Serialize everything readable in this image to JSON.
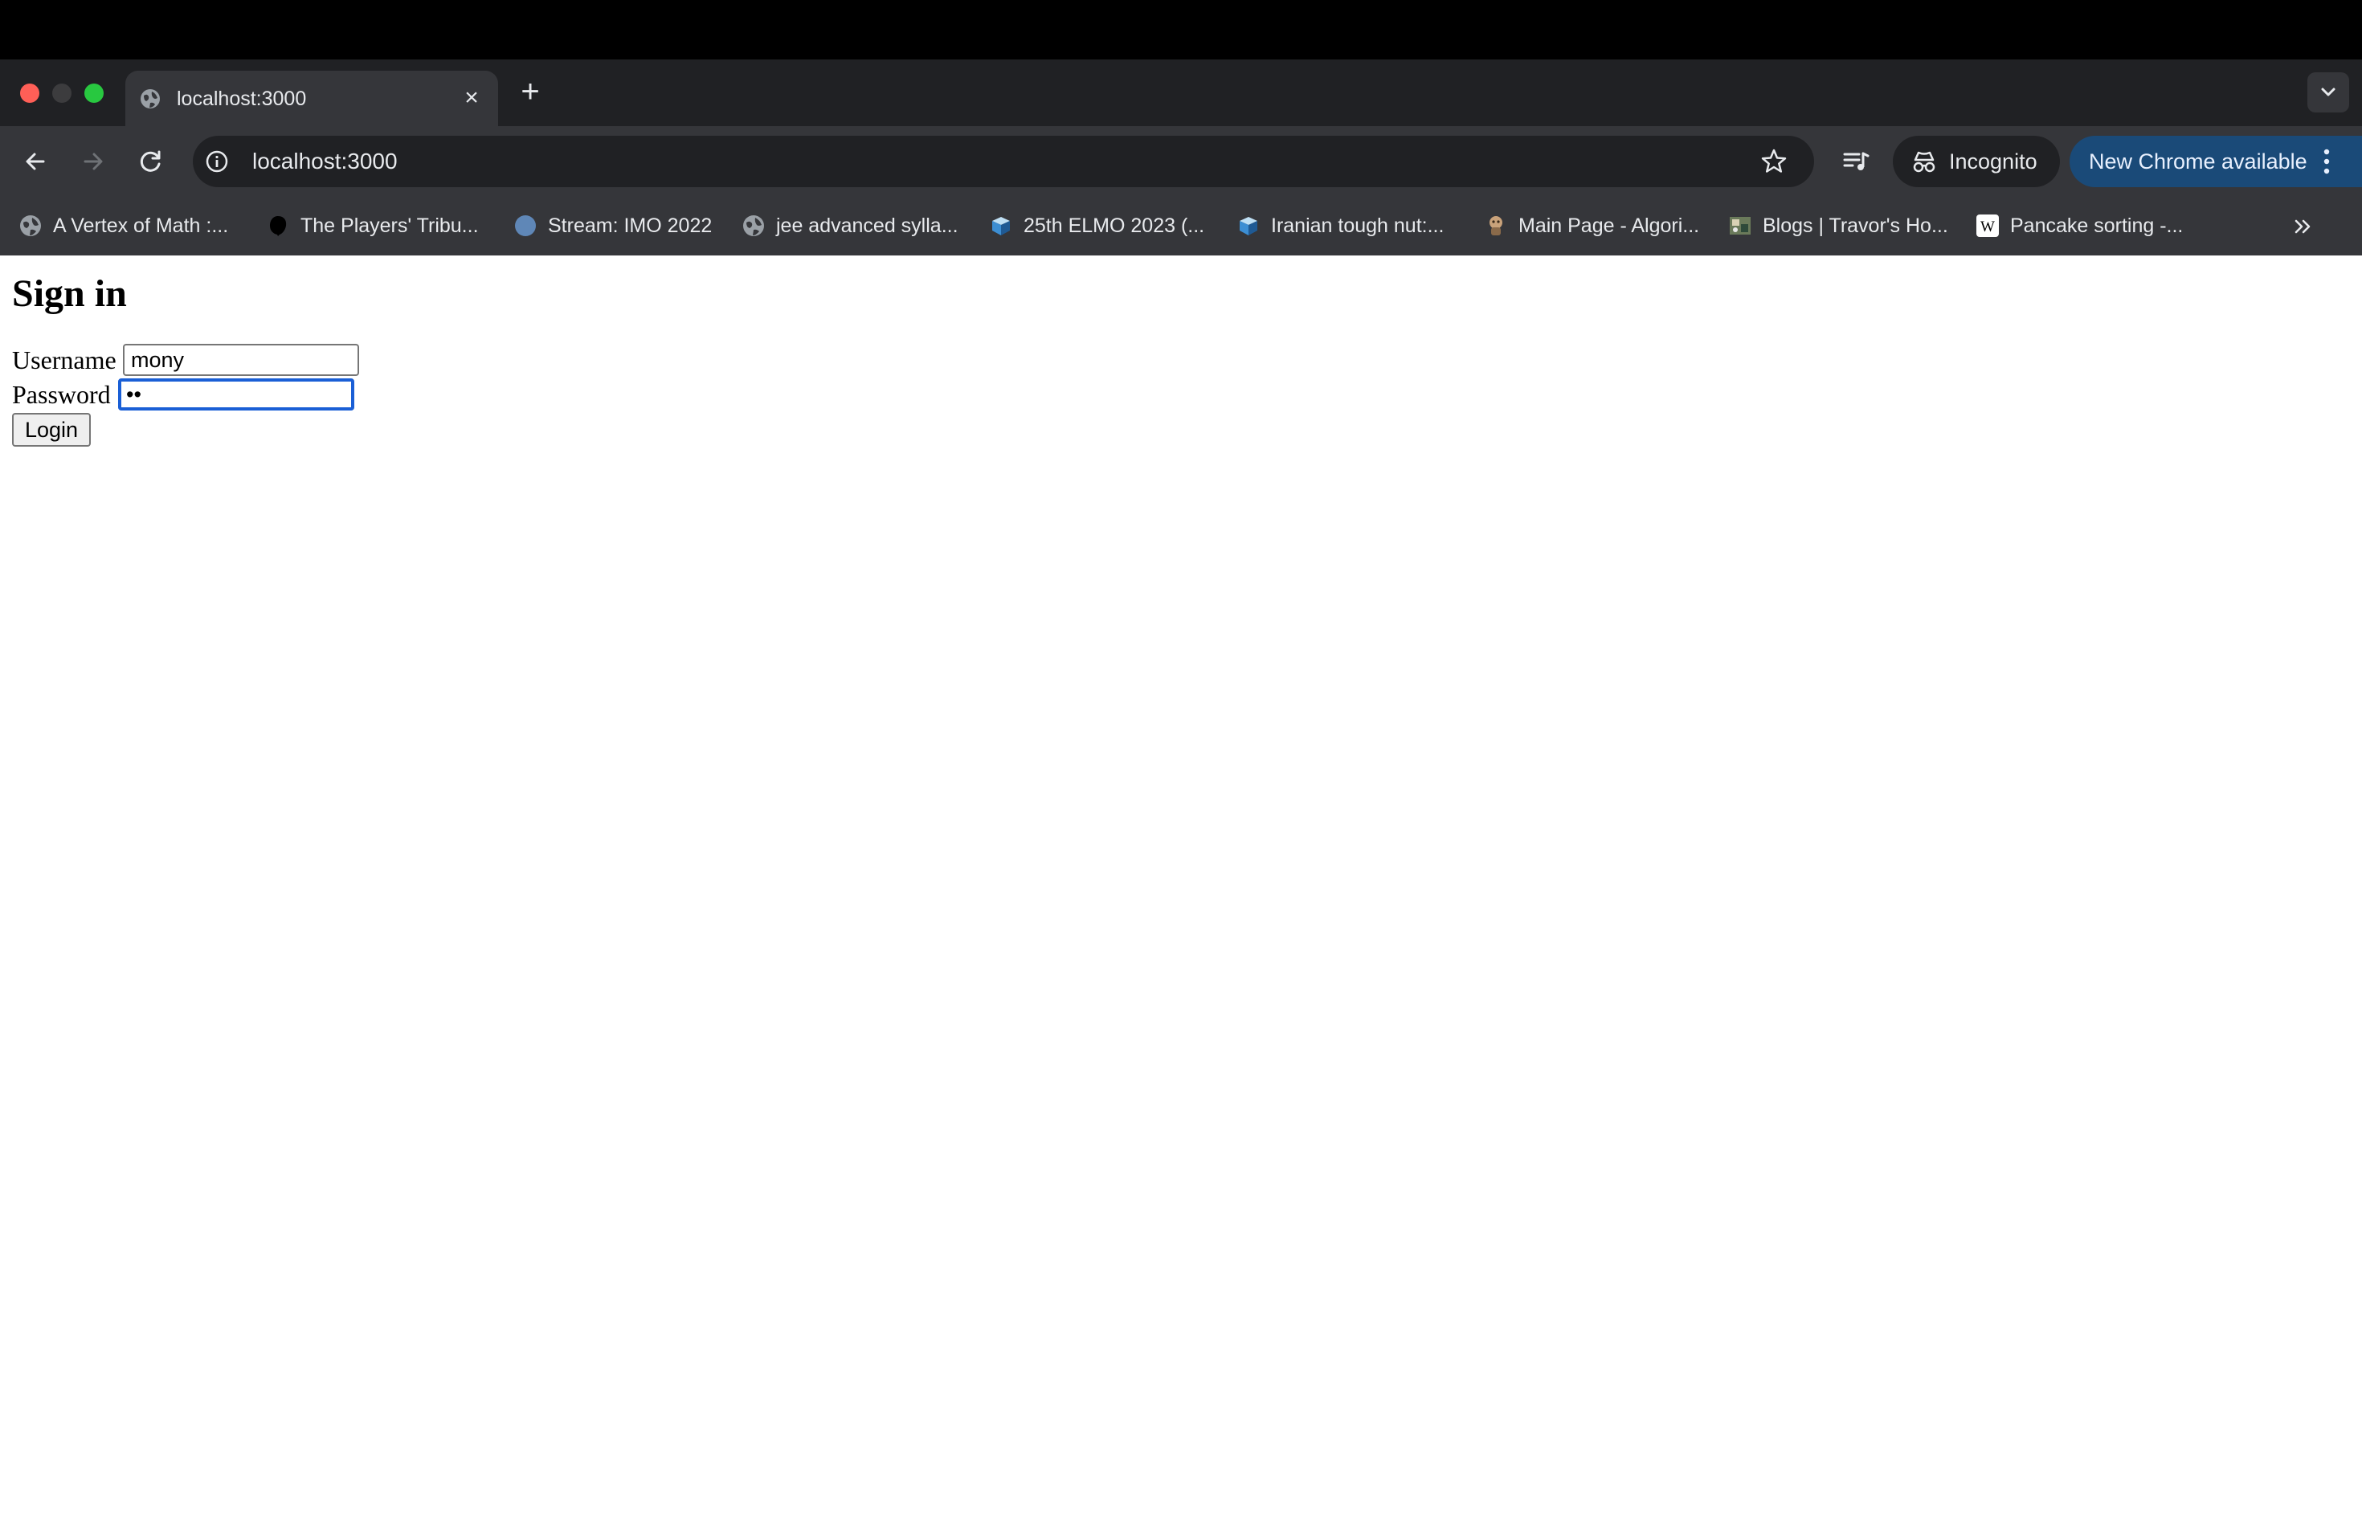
{
  "browser": {
    "tab": {
      "title": "localhost:3000"
    },
    "omnibox": {
      "url": "localhost:3000"
    },
    "incognito_label": "Incognito",
    "update_label": "New Chrome available",
    "bookmarks": [
      {
        "label": "A Vertex of Math :...",
        "icon": "globe-icon"
      },
      {
        "label": "The Players' Tribu...",
        "icon": "players-tribune-icon"
      },
      {
        "label": "Stream: IMO 2022",
        "icon": "zulip-icon"
      },
      {
        "label": "jee advanced sylla...",
        "icon": "globe-icon"
      },
      {
        "label": "25th ELMO 2023 (...",
        "icon": "aops-cube-icon"
      },
      {
        "label": "Iranian tough nut:...",
        "icon": "aops-cube-icon"
      },
      {
        "label": "Main Page - Algori...",
        "icon": "algorithmica-icon"
      },
      {
        "label": "Blogs | Travor's Ho...",
        "icon": "blog-thumbnail-icon"
      },
      {
        "label": "Pancake sorting -...",
        "icon": "wikipedia-icon"
      }
    ],
    "colors": {
      "tab_strip": "#202124",
      "toolbar": "#35363a",
      "update_pill": "#1a4a78",
      "focus_ring": "#1a5fd6"
    }
  },
  "page": {
    "title": "Sign in",
    "username_label": "Username",
    "username_value": "mony",
    "password_label": "Password",
    "password_value": "••",
    "login_button": "Login"
  }
}
